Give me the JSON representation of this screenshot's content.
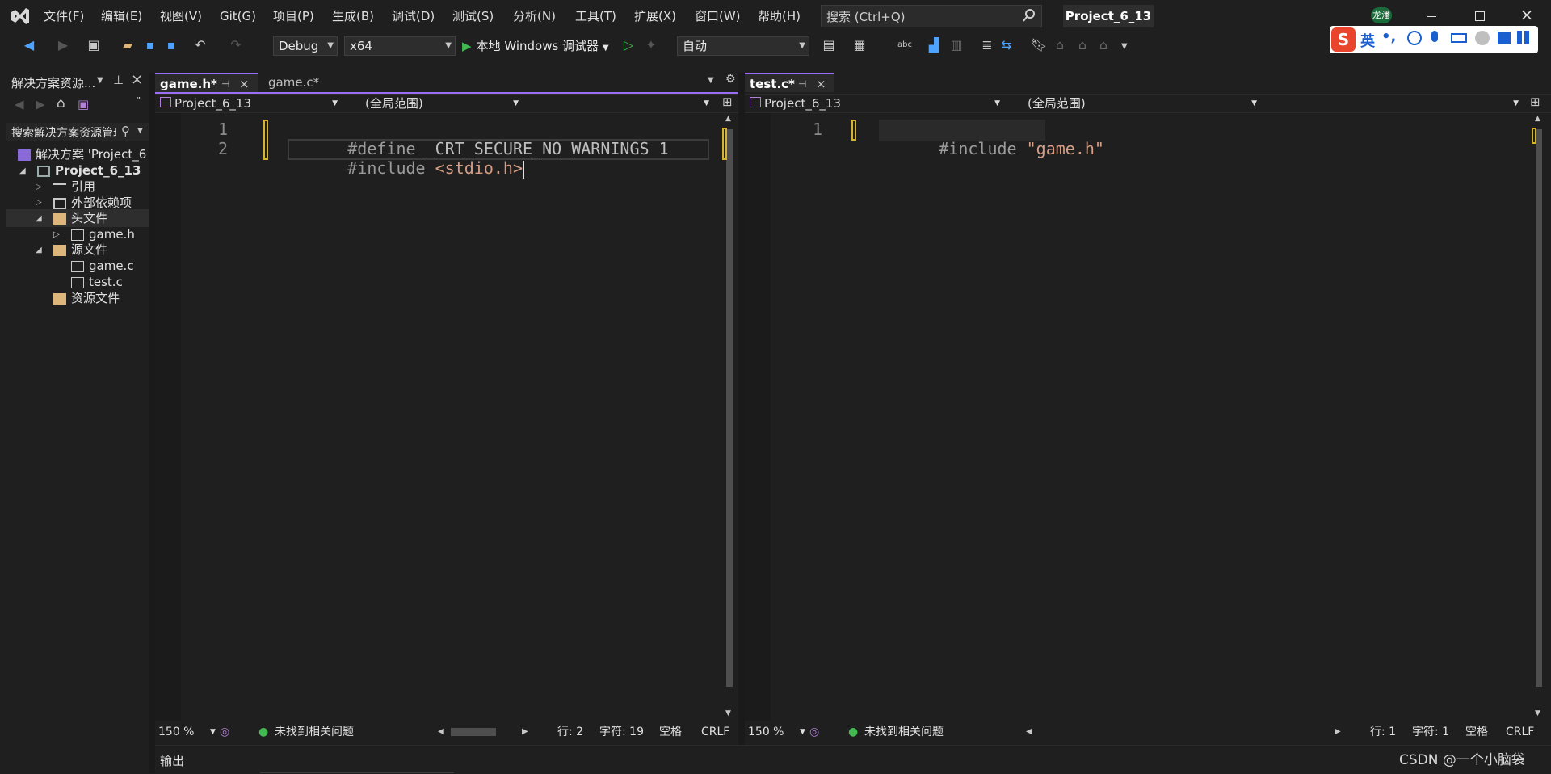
{
  "menu": [
    "文件(F)",
    "编辑(E)",
    "视图(V)",
    "Git(G)",
    "项目(P)",
    "生成(B)",
    "调试(D)",
    "测试(S)",
    "分析(N)",
    "工具(T)",
    "扩展(X)",
    "窗口(W)",
    "帮助(H)"
  ],
  "search": {
    "placeholder": "搜索 (Ctrl+Q)"
  },
  "project_title": "Project_6_13",
  "user_badge": "龙潘",
  "toolbar": {
    "config": "Debug",
    "platform": "x64",
    "run_label": "本地 Windows 调试器",
    "auto": "自动"
  },
  "ime": {
    "lang": "英",
    "punct": "•,"
  },
  "solution_explorer": {
    "title": "解决方案资源...",
    "search_placeholder": "搜索解决方案资源管理",
    "items": [
      {
        "label": "解决方案 'Project_6",
        "icon": "solution-icon"
      },
      {
        "label": "Project_6_13",
        "icon": "project-icon"
      },
      {
        "label": "引用",
        "icon": "references-icon"
      },
      {
        "label": "外部依赖项",
        "icon": "external-deps-icon"
      },
      {
        "label": "头文件",
        "icon": "folder-icon"
      },
      {
        "label": "game.h",
        "icon": "header-file-icon"
      },
      {
        "label": "源文件",
        "icon": "folder-icon"
      },
      {
        "label": "game.c",
        "icon": "c-file-icon"
      },
      {
        "label": "test.c",
        "icon": "c-file-icon"
      },
      {
        "label": "资源文件",
        "icon": "folder-icon"
      }
    ]
  },
  "left_editor": {
    "tabs": [
      "game.h*",
      "game.c*"
    ],
    "nav_project": "Project_6_13",
    "nav_scope": "(全局范围)",
    "lines": [
      {
        "num": "1",
        "pre": "#define",
        "rest": " _CRT_SECURE_NO_WARNINGS 1"
      },
      {
        "num": "2",
        "pre": "#include",
        "rest": " <stdio.h>"
      }
    ],
    "status": {
      "zoom": "150 %",
      "issues": "未找到相关问题",
      "line": "行: 2",
      "char": "字符: 19",
      "space": "空格",
      "eol": "CRLF"
    }
  },
  "right_editor": {
    "tabs": [
      "test.c*"
    ],
    "nav_project": "Project_6_13",
    "nav_scope": "(全局范围)",
    "lines": [
      {
        "num": "1",
        "pre": "#include",
        "rest": " \"game.h\""
      }
    ],
    "status": {
      "zoom": "150 %",
      "issues": "未找到相关问题",
      "line": "行: 1",
      "char": "字符: 1",
      "space": "空格",
      "eol": "CRLF"
    }
  },
  "output_label": "输出",
  "watermark": "CSDN @一个小脑袋",
  "colors": {
    "accent": "#9b6ff3",
    "marker": "#d7b430",
    "ok": "#3fb950",
    "run": "#3fb950"
  }
}
